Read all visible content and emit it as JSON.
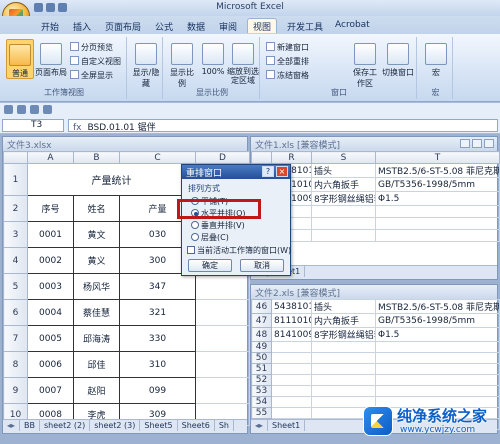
{
  "app": {
    "title": "Microsoft Excel"
  },
  "ribbon_tabs": [
    "开始",
    "插入",
    "页面布局",
    "公式",
    "数据",
    "审阅",
    "视图",
    "开发工具",
    "Acrobat"
  ],
  "active_tab": "视图",
  "ribbon": {
    "workbook_views": {
      "label": "工作簿视图",
      "normal": "普通",
      "page_layout": "页面布局",
      "page_break": "分页预览",
      "custom": "自定义视图",
      "fullscreen": "全屏显示"
    },
    "show_hide": {
      "label": "显示/隐藏"
    },
    "zoom": {
      "label": "显示比例",
      "zoom": "显示比例",
      "pct": "100%",
      "to_selection": "缩放到选定区域"
    },
    "window": {
      "label": "窗口",
      "new_window": "新建窗口",
      "arrange_all": "全部重排",
      "freeze": "冻结窗格",
      "save_ws": "保存工作区",
      "switch": "切换窗口"
    },
    "macros": {
      "label": "宏",
      "macro": "宏"
    }
  },
  "formula_bar": {
    "name_box": "T3",
    "fx": "fx",
    "content": "BSD.01.01 锯伴"
  },
  "window1": {
    "title": "文件3.xlsx",
    "columns": [
      "A",
      "B",
      "C",
      "D"
    ],
    "sheet_title": "产量统计",
    "headers": [
      "序号",
      "姓名",
      "产量"
    ],
    "rows": [
      {
        "n": "3",
        "id": "0001",
        "name": "黄文",
        "qty": "030"
      },
      {
        "n": "4",
        "id": "0002",
        "name": "黄义",
        "qty": "300"
      },
      {
        "n": "5",
        "id": "0003",
        "name": "杨风华",
        "qty": "347"
      },
      {
        "n": "6",
        "id": "0004",
        "name": "蔡佳慧",
        "qty": "321"
      },
      {
        "n": "7",
        "id": "0005",
        "name": "邱海涛",
        "qty": "330"
      },
      {
        "n": "8",
        "id": "0006",
        "name": "邱佳",
        "qty": "310"
      },
      {
        "n": "9",
        "id": "0007",
        "name": "赵阳",
        "qty": "099"
      },
      {
        "n": "10",
        "id": "0008",
        "name": "李虎",
        "qty": "309"
      }
    ],
    "row_labels": [
      "1",
      "2"
    ],
    "sheets": [
      "BB",
      "sheet2 (2)",
      "sheet2 (3)",
      "Sheet5",
      "Sheet6",
      "Sh"
    ]
  },
  "window2": {
    "title": "文件1.xls [兼容模式]",
    "columns": [
      "R",
      "S",
      "T"
    ],
    "rows": [
      {
        "n": "1",
        "r": "54381018",
        "s": "插头",
        "t": "MSTB2.5/6-ST-5.08 菲尼克斯"
      },
      {
        "n": "2",
        "r": "81110105",
        "s": "内六角扳手",
        "t": "GB/T5356-1998/5mm"
      },
      {
        "n": "3",
        "r": "81410090",
        "s": "8字形钢丝绳铝套",
        "t": "Φ1.5"
      },
      {
        "n": "4",
        "r": "",
        "s": "",
        "t": ""
      },
      {
        "n": "5",
        "r": "",
        "s": "",
        "t": ""
      },
      {
        "n": "6",
        "r": "",
        "s": "",
        "t": ""
      }
    ],
    "sheet": "Sheet1"
  },
  "window3": {
    "title": "文件2.xls [兼容模式]",
    "rows": [
      {
        "n": "46",
        "r": "54381018",
        "s": "插头",
        "t": "MSTB2.5/6-ST-5.08 菲尼克斯"
      },
      {
        "n": "47",
        "r": "81110105",
        "s": "内六角扳手",
        "t": "GB/T5356-1998/5mm"
      },
      {
        "n": "48",
        "r": "81410090",
        "s": "8字形钢丝绳铝套",
        "t": "Φ1.5"
      },
      {
        "n": "49",
        "r": "",
        "s": "",
        "t": ""
      },
      {
        "n": "50",
        "r": "",
        "s": "",
        "t": ""
      },
      {
        "n": "51",
        "r": "",
        "s": "",
        "t": ""
      },
      {
        "n": "52",
        "r": "",
        "s": "",
        "t": ""
      },
      {
        "n": "53",
        "r": "",
        "s": "",
        "t": ""
      },
      {
        "n": "54",
        "r": "",
        "s": "",
        "t": ""
      },
      {
        "n": "55",
        "r": "",
        "s": "",
        "t": ""
      },
      {
        "n": "56",
        "r": "",
        "s": "",
        "t": ""
      }
    ],
    "sheet": "Sheet1"
  },
  "dialog": {
    "title": "重排窗口",
    "help": "?",
    "close": "×",
    "section": "排列方式",
    "options": [
      "平铺(T)",
      "水平并排(O)",
      "垂直并排(V)",
      "层叠(C)"
    ],
    "selected": 1,
    "checkbox": "当前活动工作簿的窗口(W)",
    "ok": "确定",
    "cancel": "取消"
  },
  "watermark": {
    "title": "纯净系统之家",
    "url": "www.ycwjzy.com"
  }
}
